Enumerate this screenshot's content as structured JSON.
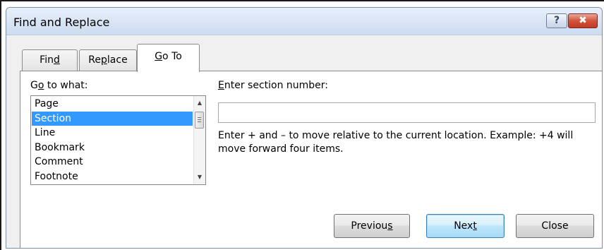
{
  "window": {
    "title": "Find and Replace",
    "help_glyph": "?",
    "close_glyph": "✖"
  },
  "tabs": [
    {
      "pre": "Fin",
      "key": "d",
      "post": ""
    },
    {
      "pre": "Re",
      "key": "p",
      "post": "lace"
    },
    {
      "pre": "",
      "key": "G",
      "post": "o To",
      "active": true
    }
  ],
  "goto": {
    "label_pre": "G",
    "label_key": "o",
    "label_post": " to what:",
    "items": [
      "Page",
      "Section",
      "Line",
      "Bookmark",
      "Comment",
      "Footnote"
    ],
    "selected": "Section"
  },
  "entry": {
    "label_pre": "",
    "label_key": "E",
    "label_post": "nter section number:",
    "value": "",
    "hint": "Enter + and – to move relative to the current location. Example: +4 will move forward four items."
  },
  "buttons": {
    "previous": {
      "pre": "Previou",
      "key": "s",
      "post": ""
    },
    "next": {
      "pre": "Nex",
      "key": "t",
      "post": ""
    },
    "close": {
      "pre": "Close",
      "key": "",
      "post": ""
    }
  },
  "icons": {
    "scroll_up": "▲",
    "scroll_down": "▼"
  }
}
